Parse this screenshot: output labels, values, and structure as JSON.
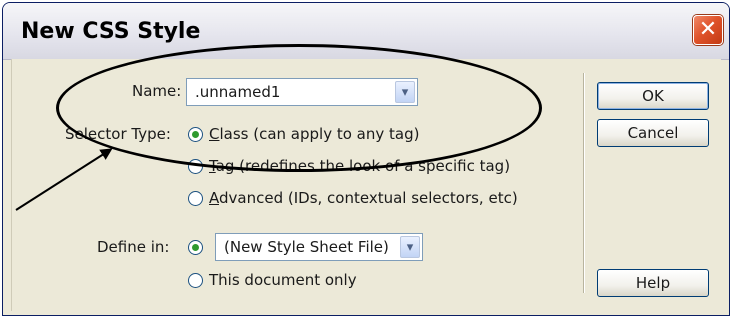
{
  "dialog": {
    "title": "New CSS Style",
    "close_glyph": "✕"
  },
  "name_field": {
    "label": "Name:",
    "value": ".unnamed1",
    "dropdown_glyph": "▾"
  },
  "selector_type": {
    "label": "Selector Type:",
    "options": [
      {
        "accel": "C",
        "rest": "lass (can apply to any tag)",
        "selected": true
      },
      {
        "accel": "T",
        "rest": "ag (redefines the look of a specific tag)",
        "selected": false
      },
      {
        "accel": "A",
        "rest": "dvanced (IDs, contextual selectors, etc)",
        "selected": false
      }
    ]
  },
  "define_in": {
    "label": "Define in:",
    "file_value": "(New Style Sheet File)",
    "dropdown_glyph": "▾",
    "this_doc_label": "This document only",
    "new_file_selected": true
  },
  "buttons": {
    "ok": "OK",
    "cancel": "Cancel",
    "help": "Help"
  },
  "colors": {
    "dialog_bg": "#ece9d8",
    "close_button": "#e0532b",
    "radio_selected": "#2f9a2f",
    "annotation": "#000000"
  },
  "icons": [
    "close-icon",
    "dropdown-arrow-icon",
    "radio-selected-icon",
    "radio-empty-icon"
  ]
}
